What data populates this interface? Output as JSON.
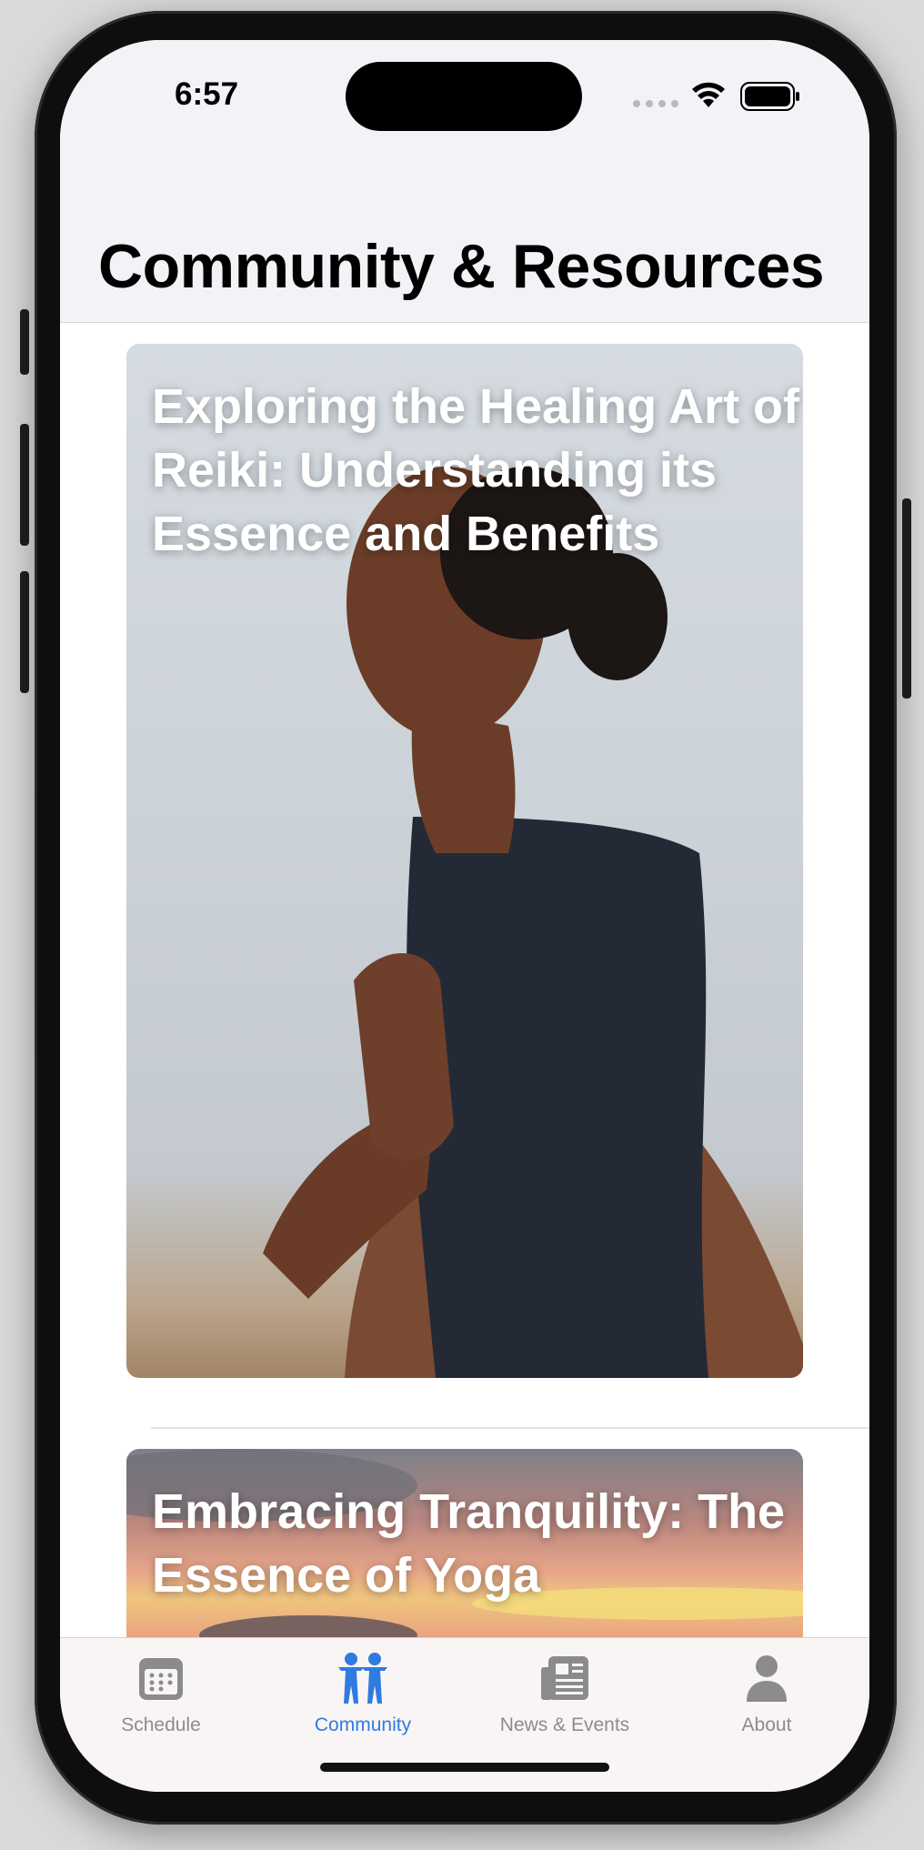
{
  "status_bar": {
    "time": "6:57"
  },
  "header": {
    "title": "Community & Resources"
  },
  "articles": [
    {
      "title": "Exploring the Healing Art of Reiki: Understanding its Essence and Benefits",
      "image": "woman-meditating-photo"
    },
    {
      "title": "Embracing Tranquility: The Essence of Yoga",
      "image": "sunset-sky-photo"
    }
  ],
  "tabs": [
    {
      "label": "Schedule",
      "icon": "calendar-icon",
      "active": false
    },
    {
      "label": "Community",
      "icon": "people-icon",
      "active": true
    },
    {
      "label": "News & Events",
      "icon": "newspaper-icon",
      "active": false
    },
    {
      "label": "About",
      "icon": "person-icon",
      "active": false
    }
  ],
  "colors": {
    "accent": "#2f7be0",
    "inactive": "#8b8b8e",
    "header_bg": "#f2f2f7"
  }
}
